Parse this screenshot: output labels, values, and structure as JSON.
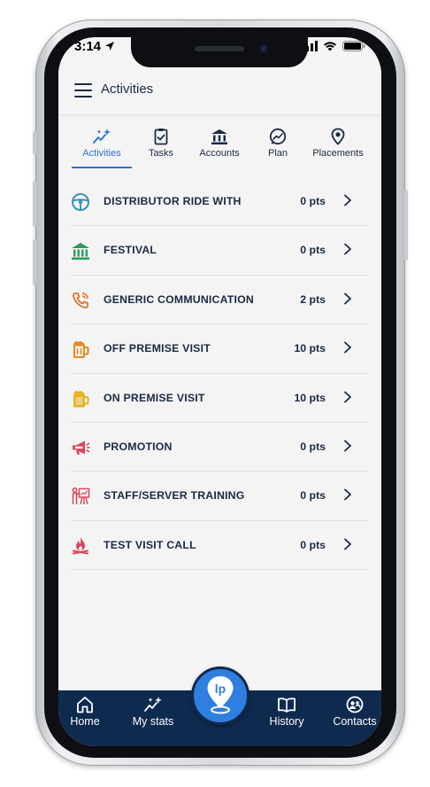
{
  "status_bar": {
    "time": "3:14"
  },
  "header": {
    "title": "Activities"
  },
  "tabs": [
    {
      "label": "Activities",
      "icon": "sparkle-icon",
      "active": true
    },
    {
      "label": "Tasks",
      "icon": "clipboard-check-icon",
      "active": false
    },
    {
      "label": "Accounts",
      "icon": "bank-icon",
      "active": false
    },
    {
      "label": "Plan",
      "icon": "trend-chat-icon",
      "active": false
    },
    {
      "label": "Placements",
      "icon": "location-pin-icon",
      "active": false
    }
  ],
  "activities": [
    {
      "label": "DISTRIBUTOR RIDE WITH",
      "points": "0 pts",
      "icon": "steering-wheel-icon",
      "color": "#3a93b8"
    },
    {
      "label": "FESTIVAL",
      "points": "0 pts",
      "icon": "bank-icon",
      "color": "#2e9a5c"
    },
    {
      "label": "GENERIC COMMUNICATION",
      "points": "2 pts",
      "icon": "phone-icon",
      "color": "#e0742a"
    },
    {
      "label": "OFF PREMISE VISIT",
      "points": "10 pts",
      "icon": "beer-mug-icon",
      "color": "#e28a1f"
    },
    {
      "label": "ON PREMISE VISIT",
      "points": "10 pts",
      "icon": "beer-mug-filled-icon",
      "color": "#e8b21e"
    },
    {
      "label": "PROMOTION",
      "points": "0 pts",
      "icon": "megaphone-icon",
      "color": "#d9455a"
    },
    {
      "label": "STAFF/SERVER TRAINING",
      "points": "0 pts",
      "icon": "presentation-icon",
      "color": "#d9455a"
    },
    {
      "label": "TEST VISIT CALL",
      "points": "0 pts",
      "icon": "campfire-icon",
      "color": "#d9455a"
    }
  ],
  "bottom_nav": {
    "home": "Home",
    "my_stats": "My stats",
    "history": "History",
    "contacts": "Contacts",
    "center_logo": "lp"
  },
  "colors": {
    "navy": "#0f2a4f",
    "accent_blue": "#2f6fd1",
    "text": "#1b2a44",
    "background": "#f4f4f5"
  }
}
